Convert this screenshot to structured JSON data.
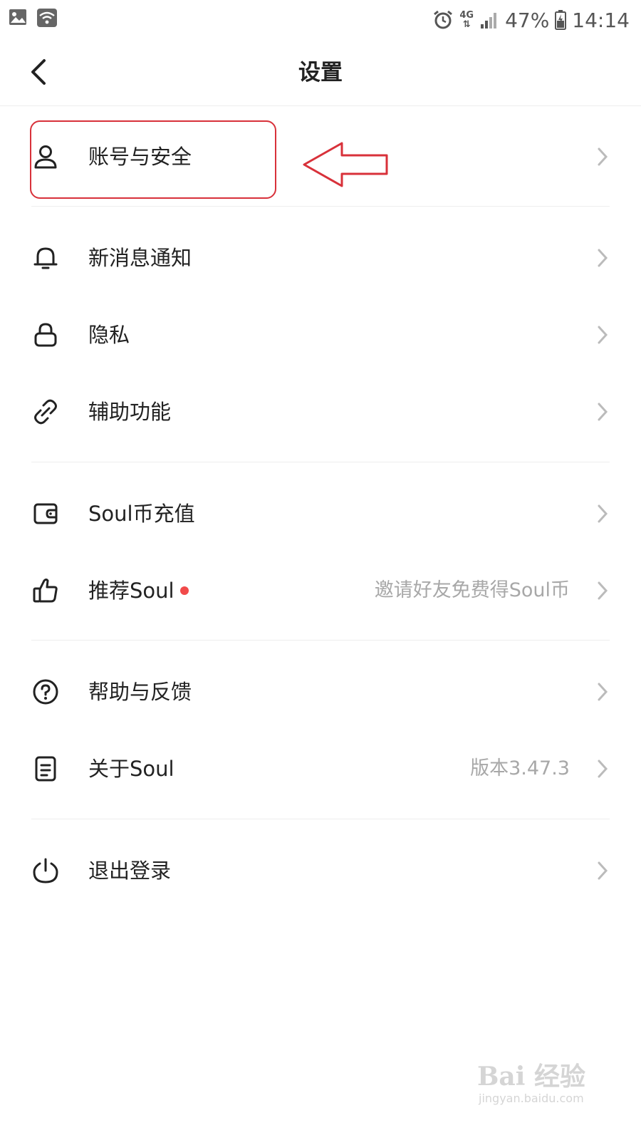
{
  "status_bar": {
    "network": "4G",
    "battery": "47%",
    "time": "14:14"
  },
  "nav": {
    "title": "设置"
  },
  "settings": {
    "account_security": {
      "label": "账号与安全"
    },
    "notifications": {
      "label": "新消息通知"
    },
    "privacy": {
      "label": "隐私"
    },
    "accessibility": {
      "label": "辅助功能"
    },
    "recharge": {
      "label": "Soul币充值"
    },
    "recommend": {
      "label": "推荐Soul",
      "value": "邀请好友免费得Soul币"
    },
    "help": {
      "label": "帮助与反馈"
    },
    "about": {
      "label": "关于Soul",
      "value": "版本3.47.3"
    },
    "logout": {
      "label": "退出登录"
    }
  },
  "watermark": {
    "brand": "Bai 经验",
    "domain": "jingyan.baidu.com"
  },
  "colors": {
    "annotation": "#d8313a",
    "badge_dot": "#f14a4a",
    "secondary_text": "#a8a8a8"
  }
}
